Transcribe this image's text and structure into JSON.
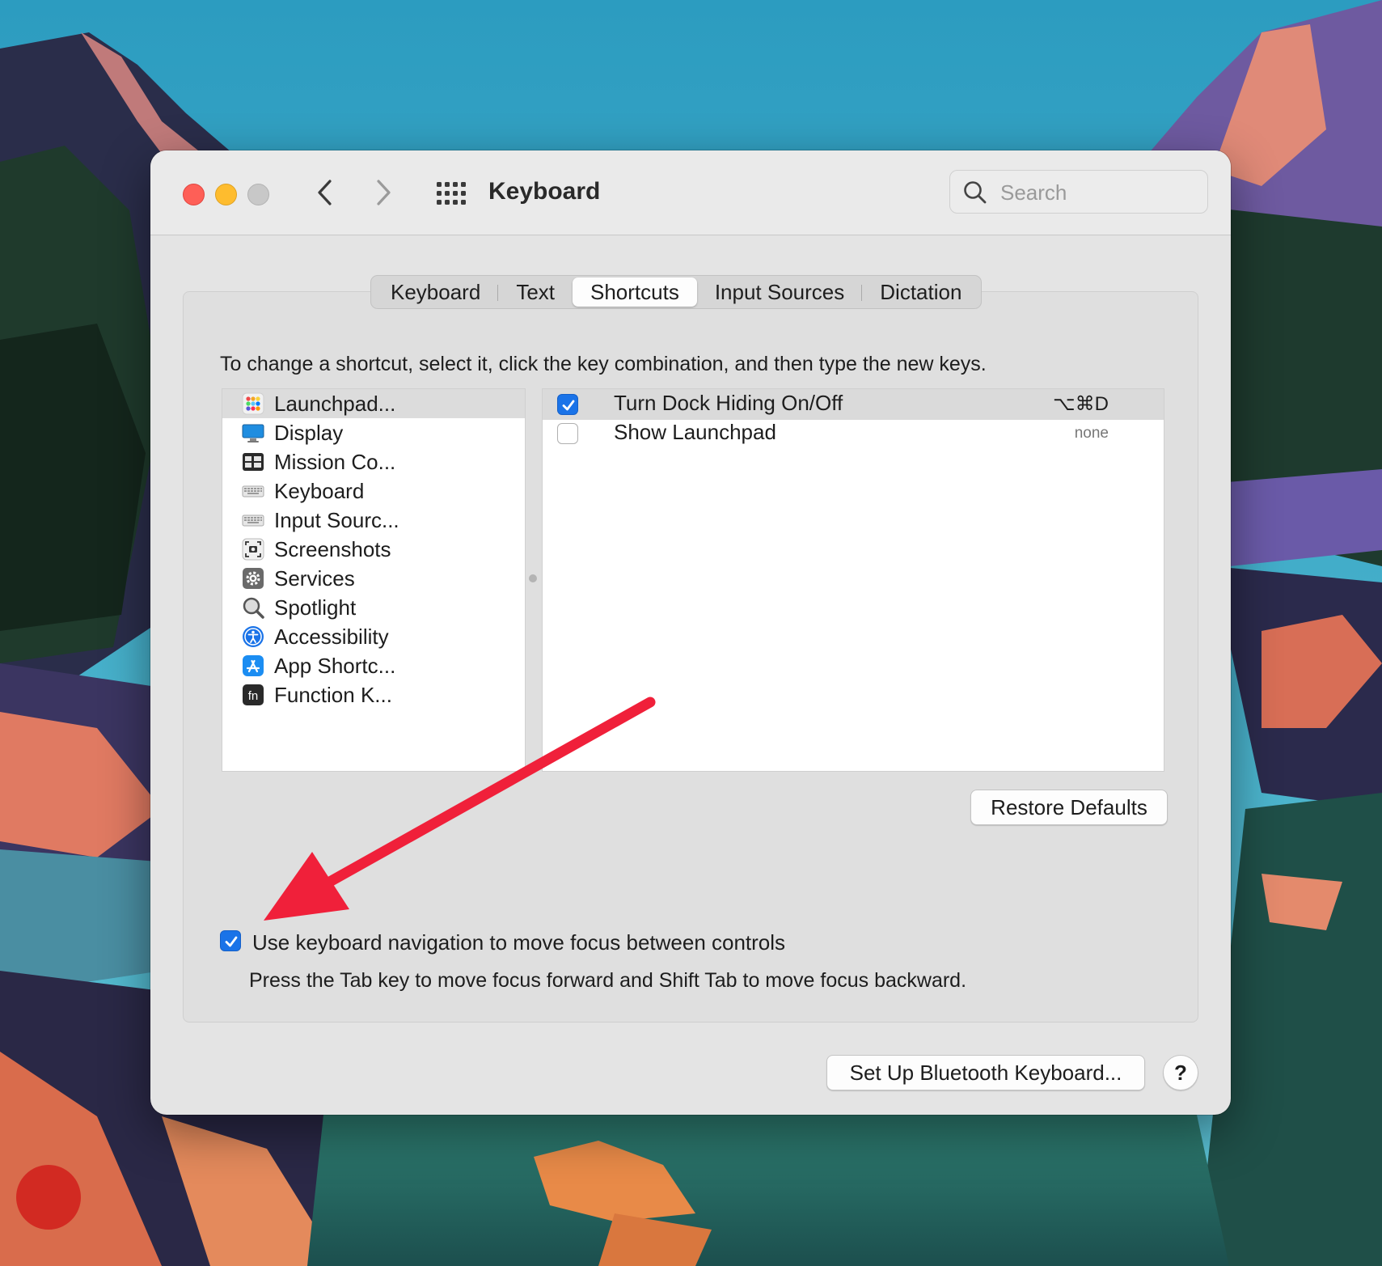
{
  "window": {
    "title": "Keyboard",
    "search_placeholder": "Search"
  },
  "tabs": [
    {
      "label": "Keyboard",
      "active": false
    },
    {
      "label": "Text",
      "active": false
    },
    {
      "label": "Shortcuts",
      "active": true
    },
    {
      "label": "Input Sources",
      "active": false
    },
    {
      "label": "Dictation",
      "active": false
    }
  ],
  "instruction": "To change a shortcut, select it, click the key combination, and then type the new keys.",
  "categories": [
    {
      "label": "Launchpad...",
      "icon": "launchpad-icon",
      "selected": true
    },
    {
      "label": "Display",
      "icon": "display-icon",
      "selected": false
    },
    {
      "label": "Mission Co...",
      "icon": "mission-control-icon",
      "selected": false
    },
    {
      "label": "Keyboard",
      "icon": "keyboard-icon",
      "selected": false
    },
    {
      "label": "Input Sourc...",
      "icon": "input-sources-icon",
      "selected": false
    },
    {
      "label": "Screenshots",
      "icon": "screenshots-icon",
      "selected": false
    },
    {
      "label": "Services",
      "icon": "services-gear-icon",
      "selected": false
    },
    {
      "label": "Spotlight",
      "icon": "spotlight-icon",
      "selected": false
    },
    {
      "label": "Accessibility",
      "icon": "accessibility-icon",
      "selected": false
    },
    {
      "label": "App Shortc...",
      "icon": "app-shortcuts-icon",
      "selected": false
    },
    {
      "label": "Function K...",
      "icon": "function-keys-icon",
      "selected": false
    }
  ],
  "shortcuts": [
    {
      "label": "Turn Dock Hiding On/Off",
      "key": "⌥⌘D",
      "checked": true,
      "selected": true
    },
    {
      "label": "Show Launchpad",
      "key": "none",
      "checked": false,
      "selected": false
    }
  ],
  "restore_defaults_label": "Restore Defaults",
  "keyboard_navigation": {
    "label": "Use keyboard navigation to move focus between controls",
    "checked": true,
    "help_text": "Press the Tab key to move focus forward and Shift Tab to move focus backward."
  },
  "bluetooth_button_label": "Set Up Bluetooth Keyboard...",
  "help_button_label": "?",
  "colors": {
    "accent": "#1a73e8",
    "annotation_arrow": "#f0203a"
  }
}
